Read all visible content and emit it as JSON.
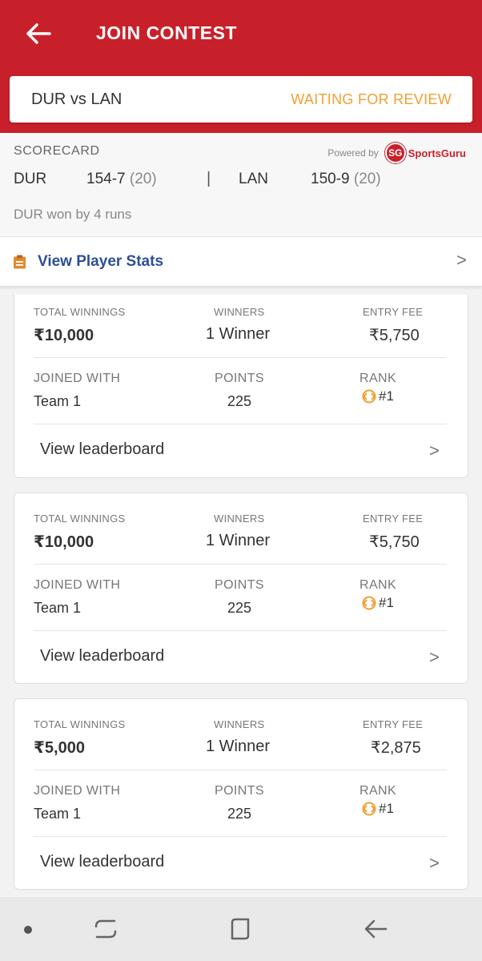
{
  "header": {
    "title": "JOIN CONTEST"
  },
  "match": {
    "name": "DUR vs LAN",
    "status": "WAITING FOR REVIEW"
  },
  "scorecard": {
    "label": "SCORECARD",
    "powered_by": "Powered by",
    "provider_badge": "SG",
    "provider_name": "SportsGuru",
    "team1": "DUR",
    "team1_score": "154-7",
    "team1_overs": "(20)",
    "separator": "|",
    "team2": "LAN",
    "team2_score": "150-9",
    "team2_overs": "(20)",
    "result": "DUR won by 4 runs"
  },
  "player_stats": {
    "label": "View Player Stats",
    "chevron": ">"
  },
  "labels": {
    "total_winnings": "TOTAL WINNINGS",
    "winners": "WINNERS",
    "entry_fee": "ENTRY FEE",
    "joined_with": "JOINED WITH",
    "points": "POINTS",
    "rank": "RANK",
    "leaderboard": "View leaderboard",
    "chevron": ">"
  },
  "contests": [
    {
      "total_winnings": "₹10,000",
      "winners": "1 Winner",
      "entry_fee": "₹5,750",
      "team": "Team  1",
      "points": "225",
      "rank": "#1"
    },
    {
      "total_winnings": "₹10,000",
      "winners": "1 Winner",
      "entry_fee": "₹5,750",
      "team": "Team  1",
      "points": "225",
      "rank": "#1"
    },
    {
      "total_winnings": "₹5,000",
      "winners": "1 Winner",
      "entry_fee": "₹2,875",
      "team": "Team  1",
      "points": "225",
      "rank": "#1"
    }
  ],
  "colors": {
    "brand_red": "#c8202a",
    "status_orange": "#f0a030",
    "link_blue": "#2c4f9a"
  }
}
